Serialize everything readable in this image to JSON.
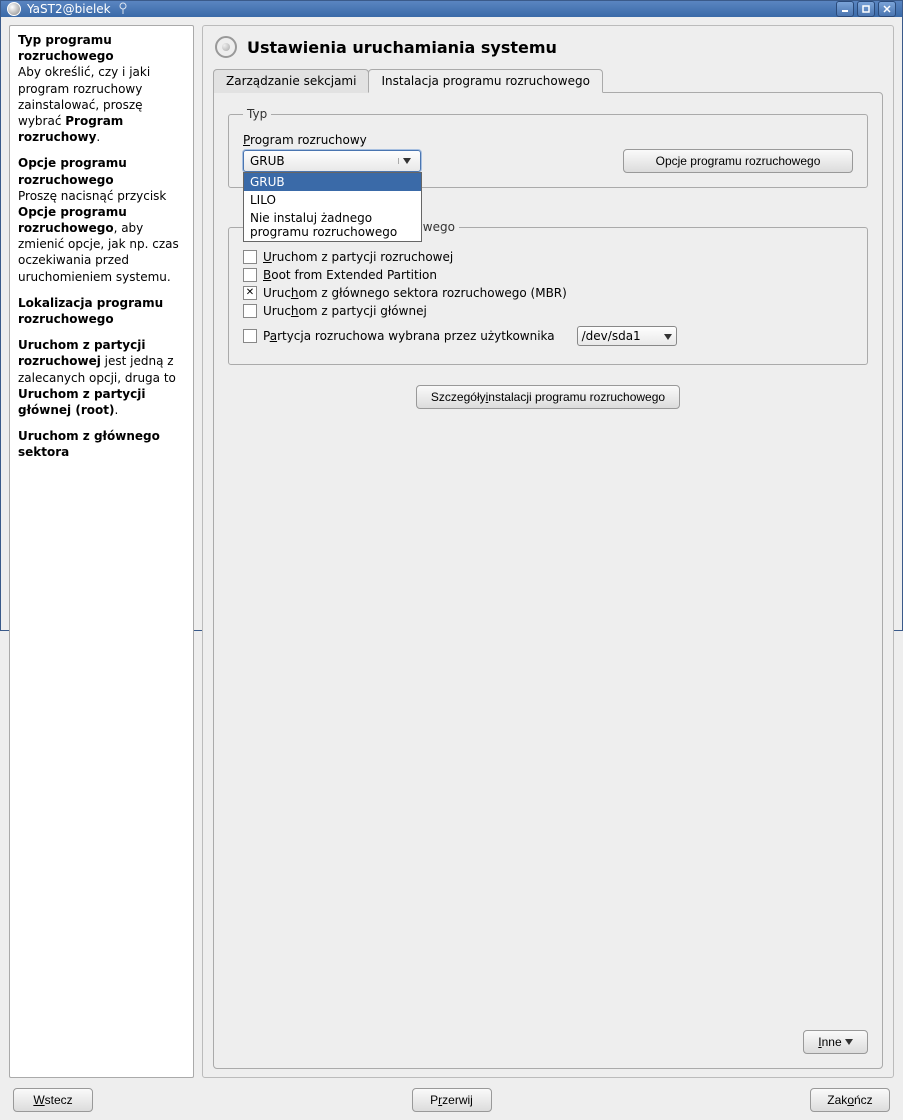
{
  "window": {
    "title": "YaST2@bielek"
  },
  "help": {
    "p1_bold": "Typ programu rozruchowego",
    "p1_text": "Aby określić, czy i jaki program rozruchowy zainstalować, proszę wybrać ",
    "p1_bold2": "Program rozruchowy",
    "p1_end": ".",
    "p2_bold": "Opcje programu rozruchowego",
    "p2_text_a": "Proszę nacisnąć przycisk ",
    "p2_bold2": "Opcje programu rozruchowego",
    "p2_text_b": ", aby zmienić opcje, jak np. czas oczekiwania przed uruchomieniem systemu.",
    "p3_bold": "Lokalizacja programu rozruchowego",
    "p4_bold1": "Uruchom z partycji rozruchowej",
    "p4_mid": " jest jedną z zalecanych opcji, druga to ",
    "p4_bold2": "Uruchom z partycji głównej (root)",
    "p4_end": ".",
    "p5_bold": "Uruchom z głównego sektora"
  },
  "header": {
    "title": "Ustawienia uruchamiania systemu"
  },
  "tabs": {
    "t0": "Zarządzanie sekcjami",
    "t1": "Instalacja programu rozruchowego"
  },
  "type_group": {
    "legend": "Typ",
    "label": "Program rozruchowy",
    "selected": "GRUB",
    "options": {
      "o0": "GRUB",
      "o1": "LILO",
      "o2": "Nie instaluj żadnego programu rozruchowego"
    },
    "opts_btn": "Opcje programu rozruchowego"
  },
  "loc_group": {
    "legend": "Położenie programu rozruchowego",
    "c0": "Uruchom z partycji rozruchowej",
    "c1": "Boot from Extended Partition",
    "c2": "Uruchom z głównego sektora rozruchowego (MBR)",
    "c3": "Uruchom z partycji głównej",
    "c4": "Partycja rozruchowa wybrana przez użytkownika",
    "part": "/dev/sda1"
  },
  "details_btn": "Szczegóły instalacji programu rozruchowego",
  "other_btn": "Inne",
  "footer": {
    "back": "Wstecz",
    "abort": "Przerwij",
    "finish": "Zakończ"
  },
  "acc": {
    "P": "P",
    "rogram": "rogram rozruchowy",
    "U": "U",
    "ruchom_boot": "ruchom z partycji rozruchowej",
    "B": "B",
    "oot_ext": "oot from Extended Partition",
    "Uruc": "Uruc",
    "h": "h",
    "om_mbr": "om z głównego sektora rozruchowego (MBR)",
    "Uruc2": "Uruc",
    "h2": "h",
    "om_root": "om z partycji głównej",
    "Pa": "P",
    "a": "a",
    "rtycja": "rtycja rozruchowa wybrana przez użytkownika",
    "Sz": "Szczegóły ",
    "i": "i",
    "nstal": "nstalacji programu rozruchowego",
    "I": "I",
    "nne": "nne",
    "W": "W",
    "stecz": "stecz",
    "Prz": "P",
    "r": "r",
    "zerwij": "zerwij",
    "Zak": "Zak",
    "o": "o",
    "ncz": "ńcz"
  }
}
